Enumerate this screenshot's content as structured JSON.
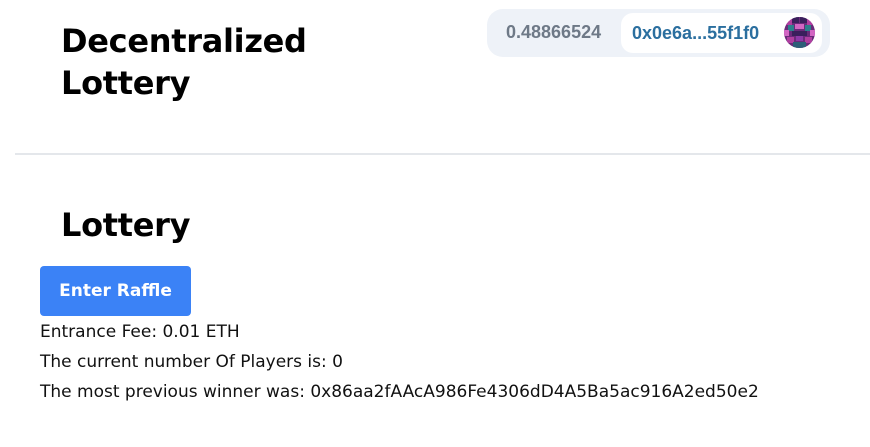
{
  "header": {
    "title": "Decentralized Lottery"
  },
  "wallet": {
    "balance": "0.48866524",
    "address": "0x0e6a...55f1f0",
    "avatar_icon": "identicon-avatar"
  },
  "main": {
    "title": "Lottery",
    "enter_button_label": "Enter Raffle",
    "entrance_fee_line": "Entrance Fee: 0.01 ETH",
    "players_line": "The current number Of Players is: 0",
    "winner_line": "The most previous winner was: 0x86aa2fAAcA986Fe4306dD4A5Ba5ac916A2ed50e2"
  },
  "colors": {
    "button_bg": "#3b82f6",
    "wallet_bg": "#eef2f8",
    "address_text": "#2b6f9f",
    "balance_text": "#6e7987"
  }
}
